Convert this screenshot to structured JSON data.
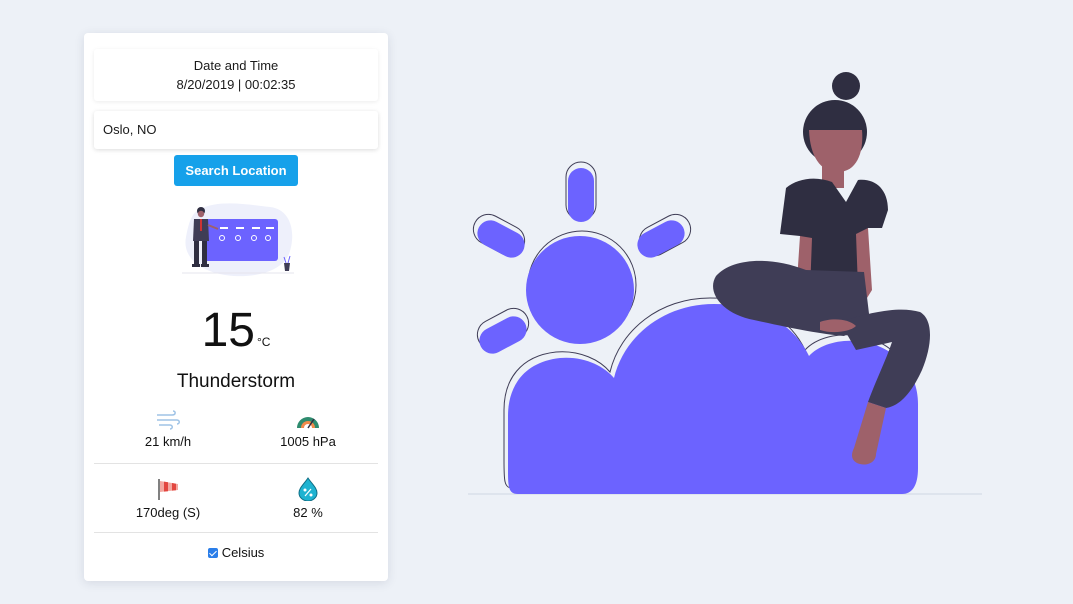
{
  "datetime": {
    "title": "Date and Time",
    "value": "8/20/2019 | 00:02:35"
  },
  "location": {
    "value": "Oslo, NO"
  },
  "search": {
    "label": "Search Location"
  },
  "weather": {
    "temperature": "15",
    "unit": "°C",
    "condition": "Thunderstorm",
    "wind_speed": "21 km/h",
    "pressure": "1005 hPa",
    "wind_direction": "170deg (S)",
    "humidity": "82 %"
  },
  "celsius_toggle": {
    "label": "Celsius",
    "checked": true
  },
  "colors": {
    "accent": "#16a1ea",
    "illustration": "#6c63ff",
    "dark": "#2f2e41",
    "skin": "#9e616a"
  },
  "icons": [
    "wind-icon",
    "pressure-gauge-icon",
    "windsock-icon",
    "humidity-drop-icon"
  ]
}
